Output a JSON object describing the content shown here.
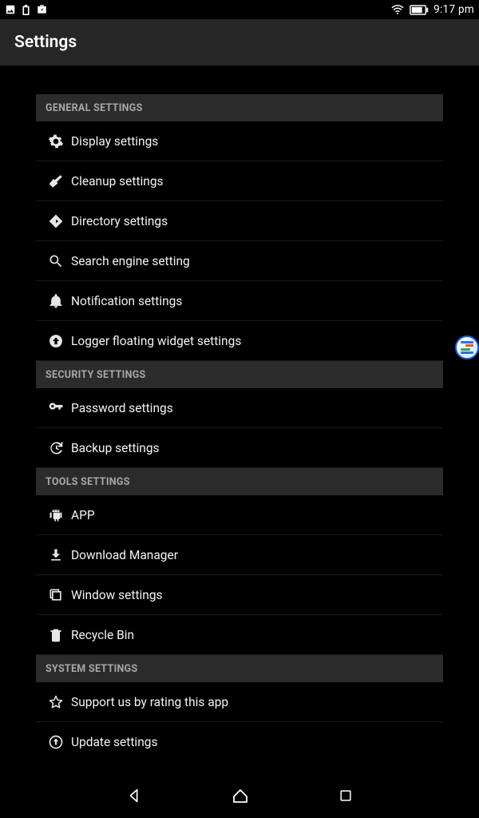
{
  "status": {
    "time": "9:17 pm"
  },
  "appbar": {
    "title": "Settings"
  },
  "sections": [
    {
      "header": "GENERAL SETTINGS",
      "items": [
        {
          "icon": "gear",
          "label": "Display settings"
        },
        {
          "icon": "broom",
          "label": "Cleanup settings"
        },
        {
          "icon": "diamond",
          "label": "Directory settings"
        },
        {
          "icon": "search",
          "label": "Search engine setting"
        },
        {
          "icon": "bell",
          "label": "Notification settings"
        },
        {
          "icon": "uparrow",
          "label": "Logger floating widget settings"
        }
      ]
    },
    {
      "header": "SECURITY SETTINGS",
      "items": [
        {
          "icon": "key",
          "label": "Password settings"
        },
        {
          "icon": "history",
          "label": "Backup settings"
        }
      ]
    },
    {
      "header": "TOOLS SETTINGS",
      "items": [
        {
          "icon": "android",
          "label": "APP"
        },
        {
          "icon": "download",
          "label": "Download Manager"
        },
        {
          "icon": "windows",
          "label": "Window settings"
        },
        {
          "icon": "trash",
          "label": "Recycle Bin"
        }
      ]
    },
    {
      "header": "SYSTEM SETTINGS",
      "items": [
        {
          "icon": "star",
          "label": "Support us by rating this app"
        },
        {
          "icon": "update",
          "label": "Update settings"
        }
      ]
    }
  ]
}
